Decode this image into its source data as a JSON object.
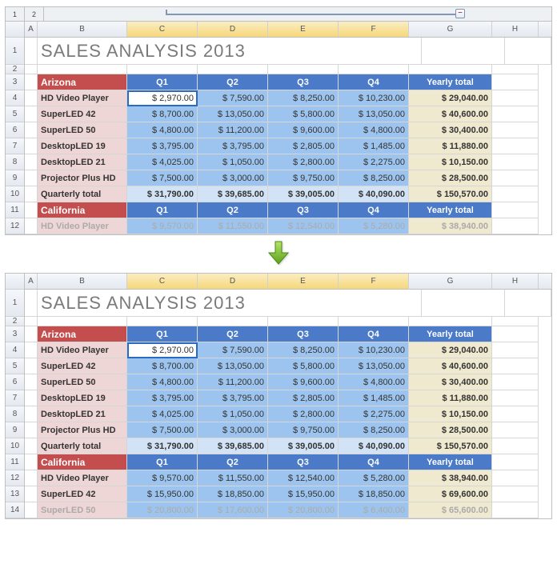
{
  "title": "SALES ANALYSIS 2013",
  "collapse_symbol": "−",
  "cols": {
    "A": "A",
    "B": "B",
    "C": "C",
    "D": "D",
    "E": "E",
    "F": "F",
    "G": "G",
    "H": "H"
  },
  "outline_levels": [
    "1",
    "2"
  ],
  "regions": {
    "arizona": {
      "name": "Arizona",
      "headers": {
        "q1": "Q1",
        "q2": "Q2",
        "q3": "Q3",
        "q4": "Q4",
        "yt": "Yearly total"
      },
      "products": [
        {
          "name": "HD Video Player",
          "q1": "$ 2,970.00",
          "q2": "$ 7,590.00",
          "q3": "$ 8,250.00",
          "q4": "$ 10,230.00",
          "yt": "$ 29,040.00"
        },
        {
          "name": "SuperLED 42",
          "q1": "$ 8,700.00",
          "q2": "$ 13,050.00",
          "q3": "$ 5,800.00",
          "q4": "$ 13,050.00",
          "yt": "$ 40,600.00"
        },
        {
          "name": "SuperLED 50",
          "q1": "$ 4,800.00",
          "q2": "$ 11,200.00",
          "q3": "$ 9,600.00",
          "q4": "$ 4,800.00",
          "yt": "$ 30,400.00"
        },
        {
          "name": "DesktopLED 19",
          "q1": "$ 3,795.00",
          "q2": "$ 3,795.00",
          "q3": "$ 2,805.00",
          "q4": "$ 1,485.00",
          "yt": "$ 11,880.00"
        },
        {
          "name": "DesktopLED 21",
          "q1": "$ 4,025.00",
          "q2": "$ 1,050.00",
          "q3": "$ 2,800.00",
          "q4": "$ 2,275.00",
          "yt": "$ 10,150.00"
        },
        {
          "name": "Projector Plus HD",
          "q1": "$ 7,500.00",
          "q2": "$ 3,000.00",
          "q3": "$ 9,750.00",
          "q4": "$ 8,250.00",
          "yt": "$ 28,500.00"
        }
      ],
      "totals": {
        "label": "Quarterly total",
        "q1": "$ 31,790.00",
        "q2": "$ 39,685.00",
        "q3": "$ 39,005.00",
        "q4": "$ 40,090.00",
        "yt": "$ 150,570.00"
      }
    },
    "california": {
      "name": "California",
      "headers": {
        "q1": "Q1",
        "q2": "Q2",
        "q3": "Q3",
        "q4": "Q4",
        "yt": "Yearly total"
      },
      "products": [
        {
          "name": "HD Video Player",
          "q1": "$ 9,570.00",
          "q2": "$ 11,550.00",
          "q3": "$ 12,540.00",
          "q4": "$ 5,280.00",
          "yt": "$ 38,940.00"
        },
        {
          "name": "SuperLED 42",
          "q1": "$ 15,950.00",
          "q2": "$ 18,850.00",
          "q3": "$ 15,950.00",
          "q4": "$ 18,850.00",
          "yt": "$ 69,600.00"
        },
        {
          "name": "SuperLED 50",
          "q1": "$ 20,800.00",
          "q2": "$ 17,600.00",
          "q3": "$ 20,800.00",
          "q4": "$ 6,400.00",
          "yt": "$ 65,600.00"
        }
      ]
    }
  },
  "chart_data": {
    "type": "table",
    "title": "SALES ANALYSIS 2013",
    "regions": [
      {
        "name": "Arizona",
        "columns": [
          "Q1",
          "Q2",
          "Q3",
          "Q4",
          "Yearly total"
        ],
        "rows": [
          {
            "label": "HD Video Player",
            "values": [
              2970,
              7590,
              8250,
              10230,
              29040
            ]
          },
          {
            "label": "SuperLED 42",
            "values": [
              8700,
              13050,
              5800,
              13050,
              40600
            ]
          },
          {
            "label": "SuperLED 50",
            "values": [
              4800,
              11200,
              9600,
              4800,
              30400
            ]
          },
          {
            "label": "DesktopLED 19",
            "values": [
              3795,
              3795,
              2805,
              1485,
              11880
            ]
          },
          {
            "label": "DesktopLED 21",
            "values": [
              4025,
              1050,
              2800,
              2275,
              10150
            ]
          },
          {
            "label": "Projector Plus HD",
            "values": [
              7500,
              3000,
              9750,
              8250,
              28500
            ]
          }
        ],
        "totals": {
          "label": "Quarterly total",
          "values": [
            31790,
            39685,
            39005,
            40090,
            150570
          ]
        }
      },
      {
        "name": "California",
        "columns": [
          "Q1",
          "Q2",
          "Q3",
          "Q4",
          "Yearly total"
        ],
        "rows": [
          {
            "label": "HD Video Player",
            "values": [
              9570,
              11550,
              12540,
              5280,
              38940
            ]
          },
          {
            "label": "SuperLED 42",
            "values": [
              15950,
              18850,
              15950,
              18850,
              69600
            ]
          },
          {
            "label": "SuperLED 50",
            "values": [
              20800,
              17600,
              20800,
              6400,
              65600
            ]
          }
        ]
      }
    ]
  }
}
